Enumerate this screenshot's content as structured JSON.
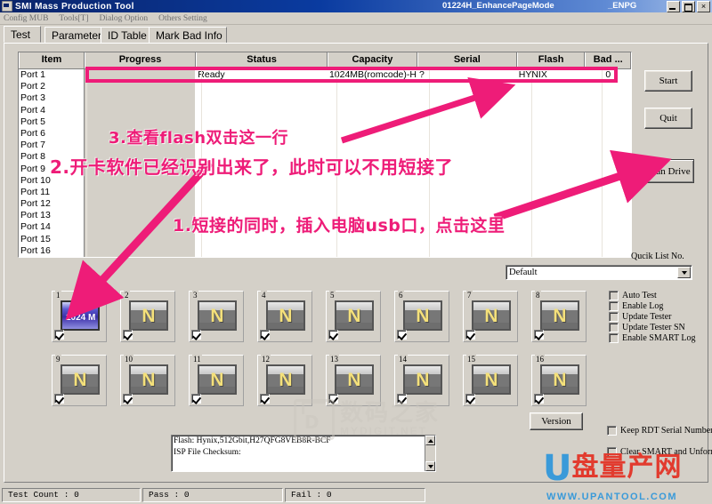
{
  "window": {
    "title": "SMI Mass Production Tool",
    "mode_text": "01224H_EnhancePageMode",
    "enpg_text": "_ENPG",
    "minimize_label": "Minimize",
    "maximize_label": "Maximize",
    "close_label": "×"
  },
  "menu": {
    "items": [
      {
        "label": "Config MUB"
      },
      {
        "label": "Tools[T]"
      },
      {
        "label": "Dialog Option"
      },
      {
        "label": "Others Setting"
      }
    ]
  },
  "tabs": [
    {
      "label": "Test",
      "selected": true
    },
    {
      "label": "Parameter",
      "selected": false
    },
    {
      "label": "ID Table",
      "selected": false
    },
    {
      "label": "Mark Bad Info",
      "selected": false
    }
  ],
  "grid": {
    "columns": [
      "Item",
      "Progress",
      "Status",
      "Capacity",
      "Serial",
      "Flash",
      "Bad ..."
    ],
    "rows": [
      {
        "item": "Port 1",
        "progress": "",
        "status": "Ready",
        "capacity": "1024MB(romcode)-H",
        "serial": "?",
        "flash": "HYNIX",
        "bad": "0",
        "highlight": true
      },
      {
        "item": "Port 2",
        "progress": "",
        "status": "",
        "capacity": "",
        "serial": "",
        "flash": "",
        "bad": ""
      },
      {
        "item": "Port 3",
        "progress": "",
        "status": "",
        "capacity": "",
        "serial": "",
        "flash": "",
        "bad": ""
      },
      {
        "item": "Port 4",
        "progress": "",
        "status": "",
        "capacity": "",
        "serial": "",
        "flash": "",
        "bad": ""
      },
      {
        "item": "Port 5",
        "progress": "",
        "status": "",
        "capacity": "",
        "serial": "",
        "flash": "",
        "bad": ""
      },
      {
        "item": "Port 6",
        "progress": "",
        "status": "",
        "capacity": "",
        "serial": "",
        "flash": "",
        "bad": ""
      },
      {
        "item": "Port 7",
        "progress": "",
        "status": "",
        "capacity": "",
        "serial": "",
        "flash": "",
        "bad": ""
      },
      {
        "item": "Port 8",
        "progress": "",
        "status": "",
        "capacity": "",
        "serial": "",
        "flash": "",
        "bad": ""
      },
      {
        "item": "Port 9",
        "progress": "",
        "status": "",
        "capacity": "",
        "serial": "",
        "flash": "",
        "bad": ""
      },
      {
        "item": "Port 10",
        "progress": "",
        "status": "",
        "capacity": "",
        "serial": "",
        "flash": "",
        "bad": ""
      },
      {
        "item": "Port 11",
        "progress": "",
        "status": "",
        "capacity": "",
        "serial": "",
        "flash": "",
        "bad": ""
      },
      {
        "item": "Port 12",
        "progress": "",
        "status": "",
        "capacity": "",
        "serial": "",
        "flash": "",
        "bad": ""
      },
      {
        "item": "Port 13",
        "progress": "",
        "status": "",
        "capacity": "",
        "serial": "",
        "flash": "",
        "bad": ""
      },
      {
        "item": "Port 14",
        "progress": "",
        "status": "",
        "capacity": "",
        "serial": "",
        "flash": "",
        "bad": ""
      },
      {
        "item": "Port 15",
        "progress": "",
        "status": "",
        "capacity": "",
        "serial": "",
        "flash": "",
        "bad": ""
      },
      {
        "item": "Port 16",
        "progress": "",
        "status": "",
        "capacity": "",
        "serial": "",
        "flash": "",
        "bad": ""
      }
    ]
  },
  "buttons": {
    "start": "Start",
    "quit": "Quit",
    "scan_drive": "Scan Drive",
    "version": "Version"
  },
  "quick_list": {
    "label": "Qucik List No.",
    "selected": "Default"
  },
  "options": {
    "right_checks": [
      {
        "label": "Auto Test",
        "checked": false
      },
      {
        "label": "Enable Log",
        "checked": false
      },
      {
        "label": "Update Tester",
        "checked": false
      },
      {
        "label": "Update Tester SN",
        "checked": false
      },
      {
        "label": "Enable SMART Log",
        "checked": false
      }
    ],
    "bottom_checks": [
      {
        "label": "Keep RDT Serial Number",
        "checked": false
      },
      {
        "label": "Clear SMART and Unformat",
        "checked": false
      }
    ]
  },
  "slots": [
    {
      "num": "1",
      "text": "1024 M",
      "kind": "blue",
      "checked": true
    },
    {
      "num": "2",
      "text": "N",
      "kind": "gray",
      "checked": true
    },
    {
      "num": "3",
      "text": "N",
      "kind": "gray",
      "checked": true
    },
    {
      "num": "4",
      "text": "N",
      "kind": "gray",
      "checked": true
    },
    {
      "num": "5",
      "text": "N",
      "kind": "gray",
      "checked": true
    },
    {
      "num": "6",
      "text": "N",
      "kind": "gray",
      "checked": true
    },
    {
      "num": "7",
      "text": "N",
      "kind": "gray",
      "checked": true
    },
    {
      "num": "8",
      "text": "N",
      "kind": "gray",
      "checked": true
    },
    {
      "num": "9",
      "text": "N",
      "kind": "gray",
      "checked": true
    },
    {
      "num": "10",
      "text": "N",
      "kind": "gray",
      "checked": true
    },
    {
      "num": "11",
      "text": "N",
      "kind": "gray",
      "checked": true
    },
    {
      "num": "12",
      "text": "N",
      "kind": "gray",
      "checked": true
    },
    {
      "num": "13",
      "text": "N",
      "kind": "gray",
      "checked": true
    },
    {
      "num": "14",
      "text": "N",
      "kind": "gray",
      "checked": true
    },
    {
      "num": "15",
      "text": "N",
      "kind": "gray",
      "checked": true
    },
    {
      "num": "16",
      "text": "N",
      "kind": "gray",
      "checked": true
    }
  ],
  "log": {
    "line1": "Flash: Hynix,512Gbit,H27QFG8VEB8R-BCF",
    "line2": "ISP File Checksum:"
  },
  "statusbar": {
    "test_count": "Test Count : 0",
    "pass": "Pass : 0",
    "fail": "Fail : 0"
  },
  "annotations": {
    "step1": "1.短接的同时，插入电脑usb口，点击这里",
    "step2": "2.开卡软件已经识别出来了，此时可以不用短接了",
    "step3": "3.查看flash双击这一行",
    "color": "#ee1c78"
  },
  "watermark": {
    "badge": "D",
    "cn": "数码之家",
    "en": "MYDIGIT.NET"
  },
  "logo": {
    "u": "U",
    "cn": "盘量产网",
    "url": "WWW.UPANTOOL.COM"
  }
}
